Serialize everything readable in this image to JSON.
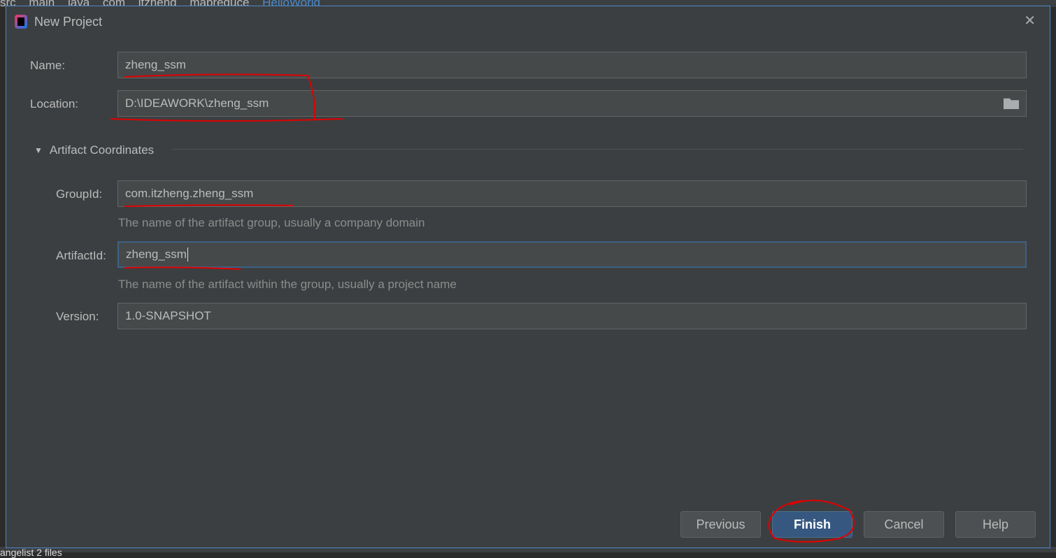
{
  "breadcrumb": [
    "src",
    "main",
    "java",
    "com",
    "itzheng",
    "mapreduce",
    "HelloWorld"
  ],
  "bottom_status": "angelist 2 files",
  "dialog": {
    "title": "New Project",
    "name_label": "Name:",
    "name_value": "zheng_ssm",
    "location_label": "Location:",
    "location_value": "D:\\IDEAWORK\\zheng_ssm",
    "section_title": "Artifact Coordinates",
    "groupid_label": "GroupId:",
    "groupid_value": "com.itzheng.zheng_ssm",
    "groupid_hint": "The name of the artifact group, usually a company domain",
    "artifactid_label": "ArtifactId:",
    "artifactid_value": "zheng_ssm",
    "artifactid_hint": "The name of the artifact within the group, usually a project name",
    "version_label": "Version:",
    "version_value": "1.0-SNAPSHOT",
    "buttons": {
      "previous": "Previous",
      "finish": "Finish",
      "cancel": "Cancel",
      "help": "Help"
    }
  },
  "colors": {
    "accent": "#4a88c7",
    "primary_button": "#365880",
    "annotation": "#e00000"
  }
}
